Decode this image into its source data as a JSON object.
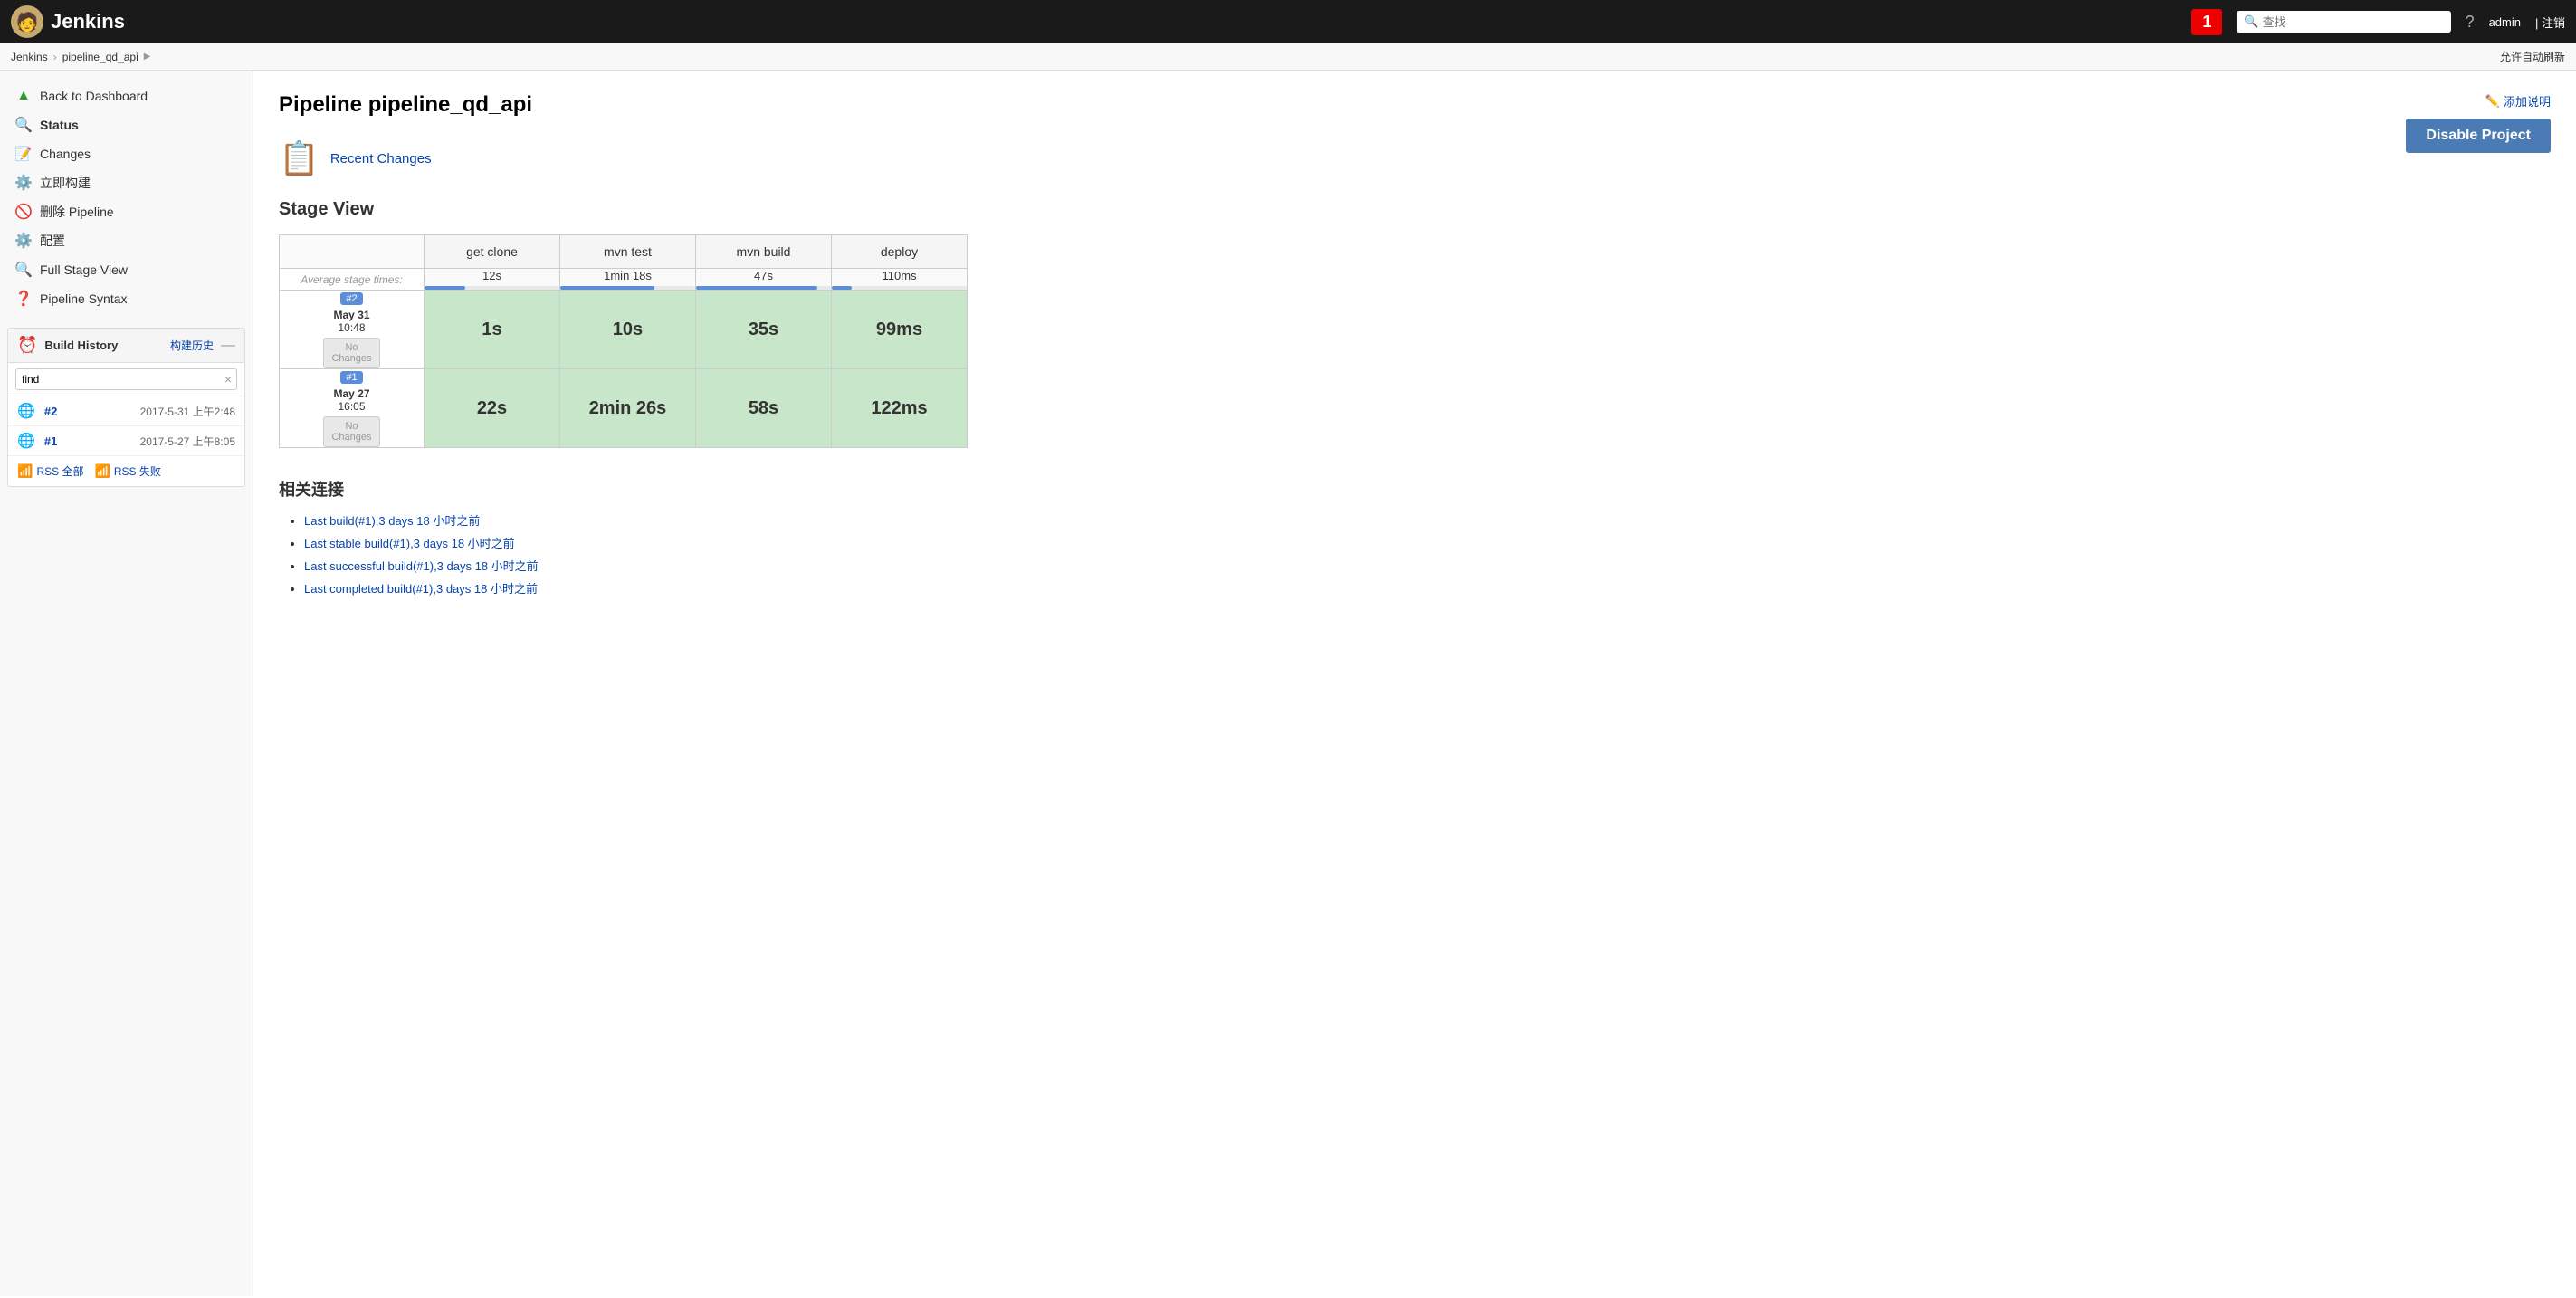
{
  "header": {
    "logo_text": "Jenkins",
    "notification_count": "1",
    "search_placeholder": "查找",
    "help_icon": "?",
    "user_name": "admin",
    "logout_label": "| 注销"
  },
  "breadcrumb": {
    "items": [
      {
        "label": "Jenkins",
        "href": "#"
      },
      {
        "label": "pipeline_qd_api",
        "href": "#"
      }
    ],
    "autorefresh_label": "允许自动刷新"
  },
  "sidebar": {
    "nav_items": [
      {
        "id": "back-to-dashboard",
        "icon": "▲",
        "icon_class": "green",
        "label": "Back to Dashboard"
      },
      {
        "id": "status",
        "icon": "🔍",
        "icon_class": "blue",
        "label": "Status"
      },
      {
        "id": "changes",
        "icon": "✏️",
        "icon_class": "blue",
        "label": "Changes"
      },
      {
        "id": "build-now",
        "icon": "⚙️",
        "icon_class": "orange",
        "label": "立即构建"
      },
      {
        "id": "delete-pipeline",
        "icon": "🚫",
        "icon_class": "red",
        "label": "删除 Pipeline"
      },
      {
        "id": "configure",
        "icon": "⚙️",
        "icon_class": "gray",
        "label": "配置"
      },
      {
        "id": "full-stage-view",
        "icon": "🔍",
        "icon_class": "blue",
        "label": "Full Stage View"
      },
      {
        "id": "pipeline-syntax",
        "icon": "❓",
        "icon_class": "blue",
        "label": "Pipeline Syntax"
      }
    ],
    "build_history": {
      "title": "Build History",
      "history_link_label": "构建历史",
      "dash_label": "—",
      "search_placeholder": "find",
      "search_value": "find",
      "builds": [
        {
          "id": "build-2",
          "number": "#2",
          "date": "2017-5-31 上午2:48"
        },
        {
          "id": "build-1",
          "number": "#1",
          "date": "2017-5-27 上午8:05"
        }
      ],
      "rss_all_label": "RSS 全部",
      "rss_fail_label": "RSS 失败"
    }
  },
  "main": {
    "page_title": "Pipeline pipeline_qd_api",
    "add_description_label": "添加说明",
    "disable_project_label": "Disable Project",
    "recent_changes_label": "Recent Changes",
    "stage_view_title": "Stage View",
    "stage_table": {
      "columns": [
        "get clone",
        "mvn test",
        "mvn build",
        "deploy"
      ],
      "avg_label": "Average stage times:",
      "avg_times": [
        "12s",
        "1min 18s",
        "47s",
        "110ms"
      ],
      "progress_widths": [
        30,
        60,
        80,
        20
      ],
      "builds": [
        {
          "tag": "#2",
          "date": "May 31",
          "time": "10:48",
          "no_changes": "No\nChanges",
          "stage_times": [
            "1s",
            "10s",
            "35s",
            "99ms"
          ]
        },
        {
          "tag": "#1",
          "date": "May 27",
          "time": "16:05",
          "no_changes": "No\nChanges",
          "stage_times": [
            "22s",
            "2min 26s",
            "58s",
            "122ms"
          ]
        }
      ]
    },
    "related_links": {
      "title": "相关连接",
      "links": [
        {
          "label": "Last build(#1),3 days 18 小时之前",
          "href": "#"
        },
        {
          "label": "Last stable build(#1),3 days 18 小时之前",
          "href": "#"
        },
        {
          "label": "Last successful build(#1),3 days 18 小时之前",
          "href": "#"
        },
        {
          "label": "Last completed build(#1),3 days 18 小时之前",
          "href": "#"
        }
      ]
    }
  }
}
